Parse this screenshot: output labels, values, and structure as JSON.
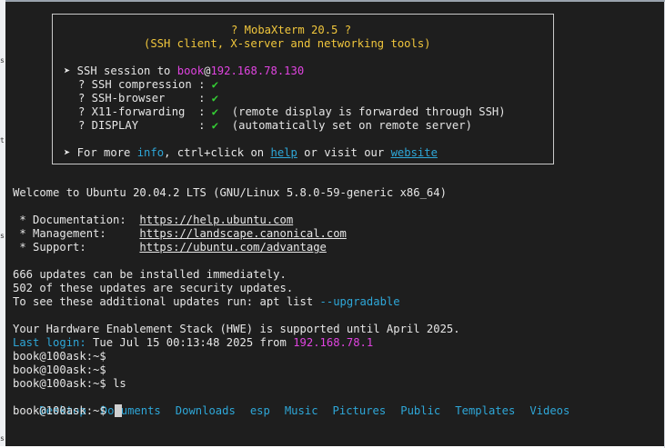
{
  "banner": {
    "title": "? MobaXterm 20.5 ?",
    "subtitle": "(SSH client, X-server and networking tools)",
    "session_prefix": "➤ SSH session to ",
    "session_user": "book",
    "session_at": "@",
    "session_host": "192.168.78.130",
    "features": [
      {
        "label": "? SSH compression : ",
        "check": "✔",
        "note": ""
      },
      {
        "label": "? SSH-browser     : ",
        "check": "✔",
        "note": ""
      },
      {
        "label": "? X11-forwarding  : ",
        "check": "✔",
        "note": "  (remote display is forwarded through SSH)"
      },
      {
        "label": "? DISPLAY         : ",
        "check": "✔",
        "note": "  (automatically set on remote server)"
      }
    ],
    "more_prefix": "➤ For more ",
    "more_info": "info",
    "more_mid": ", ctrl+click on ",
    "more_help": "help",
    "more_visit": " or visit our ",
    "more_website": "website"
  },
  "terminal": {
    "welcome": "Welcome to Ubuntu 20.04.2 LTS (GNU/Linux 5.8.0-59-generic x86_64)",
    "docs_label": " * Documentation:  ",
    "docs_url": "https://help.ubuntu.com",
    "mgmt_label": " * Management:     ",
    "mgmt_url": "https://landscape.canonical.com",
    "support_label": " * Support:        ",
    "support_url": "https://ubuntu.com/advantage",
    "updates_1": "666 updates can be installed immediately.",
    "updates_2": "502 of these updates are security updates.",
    "updates_3_prefix": "To see these additional updates run: apt list ",
    "updates_3_flag": "--upgradable",
    "hwe": "Your Hardware Enablement Stack (HWE) is supported until April 2025.",
    "last_login_label": "Last login:",
    "last_login_date": " Tue Jul 15 00:13:48 2025 from ",
    "last_login_ip": "192.168.78.1",
    "prompt": "book@100ask:~$",
    "command": " ls",
    "dirs": [
      "Desktop",
      "Documents",
      "Downloads",
      "esp",
      "Music",
      "Pictures",
      "Public",
      "Templates",
      "Videos"
    ]
  },
  "colors": {
    "background": "#1e1e1e",
    "text": "#e6e6e6",
    "yellow": "#f0c63c",
    "magenta": "#e044e0",
    "cyan": "#2ea7d8",
    "green": "#35d135"
  }
}
